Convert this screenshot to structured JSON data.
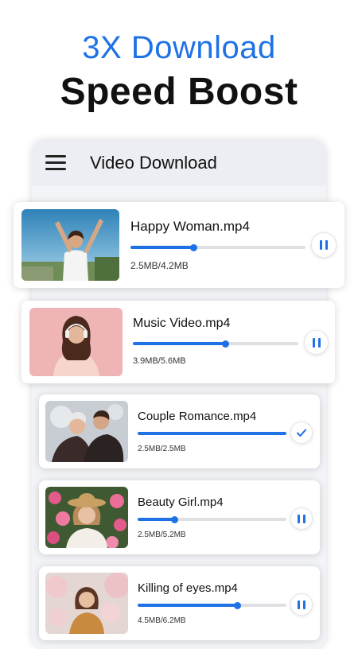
{
  "promo": {
    "line1": "3X Download",
    "line2": "Speed Boost"
  },
  "accent_color": "#1e72e6",
  "app": {
    "title": "Video Download",
    "menu_icon": "hamburger-menu-icon"
  },
  "downloads": [
    {
      "name": "Happy Woman.mp4",
      "size": "2.5MB/4.2MB",
      "progress": 0.36,
      "state": "downloading",
      "action_icon": "pause-icon"
    },
    {
      "name": "Music Video.mp4",
      "size": "3.9MB/5.6MB",
      "progress": 0.56,
      "state": "downloading",
      "action_icon": "pause-icon"
    },
    {
      "name": "Couple Romance.mp4",
      "size": "2.5MB/2.5MB",
      "progress": 1.0,
      "state": "completed",
      "action_icon": "check-icon"
    },
    {
      "name": "Beauty Girl.mp4",
      "size": "2.5MB/5.2MB",
      "progress": 0.25,
      "state": "downloading",
      "action_icon": "pause-icon"
    },
    {
      "name": "Killing of eyes.mp4",
      "size": "4.5MB/6.2MB",
      "progress": 0.67,
      "state": "downloading",
      "action_icon": "pause-icon"
    }
  ]
}
